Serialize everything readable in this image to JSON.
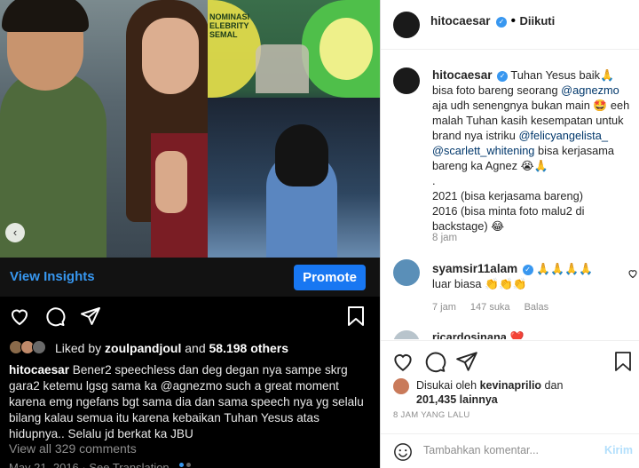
{
  "left_panel": {
    "prev_arrow": "‹",
    "insights_label": "View Insights",
    "promote_label": "Promote",
    "liked_by_prefix": "Liked by ",
    "liked_by_user": "zoulpandjoul",
    "liked_by_and": " and ",
    "liked_by_count": "58.198 others",
    "caption_user": "hitocaesar",
    "caption_text": " Bener2 speechless dan deg degan nya sampe skrg gara2 ketemu lgsg sama ka @agnezmo such a great moment karena emg ngefans bgt sama dia dan sama speech nya yg selalu bilang kalau semua itu karena kebaikan Tuhan Yesus atas hidupnya.. Selalu jd berkat ka JBU",
    "view_comments": "View all 329 comments",
    "bottom_cut_text": "May 21, 2016 · See Translation",
    "photo_sign_text": "NOMINASI ELEBRITY SEMAL"
  },
  "right_panel": {
    "header_user": "hitocaesar",
    "verified_mark": "✓",
    "follow_sep": " • ",
    "follow_label": "Diikuti",
    "caption": {
      "user": "hitocaesar",
      "p1": " Tuhan Yesus baik🙏 bisa foto bareng seorang ",
      "m1": "@agnezmo",
      "p2": " aja udh senengnya bukan main 🤩 eeh malah Tuhan kasih kesempatan untuk brand nya istriku ",
      "m2": "@felicyangelista_",
      "p3": " ",
      "m3": "@scarlett_whitening",
      "p4": " bisa kerjasama bareng ka Agnez 😭🙏",
      "line_dot": ".",
      "line_2021": "2021 (bisa kerjasama bareng)",
      "line_2016": "2016 (bisa minta foto malu2 di backstage) 😂",
      "time": "8 jam"
    },
    "comment1": {
      "user": "syamsir11alam",
      "text_a": " 🙏🙏🙏🙏",
      "text_b": "luar biasa 👏👏👏",
      "time": "7 jam",
      "likes": "147 suka",
      "reply": "Balas"
    },
    "comment2": {
      "user": "ricardosinana",
      "text": " ❤️"
    },
    "likes": {
      "prefix": "Disukai oleh ",
      "user": "kevinaprilio",
      "and": " dan",
      "count": "201,435 lainnya"
    },
    "post_time": "8 JAM YANG LALU",
    "comment_placeholder": "Tambahkan komentar...",
    "post_label": "Kirim"
  },
  "colors": {
    "link_blue": "#3797f0",
    "promote_blue": "#1877f2",
    "mention": "#00376b",
    "muted": "#8e8e8e"
  }
}
